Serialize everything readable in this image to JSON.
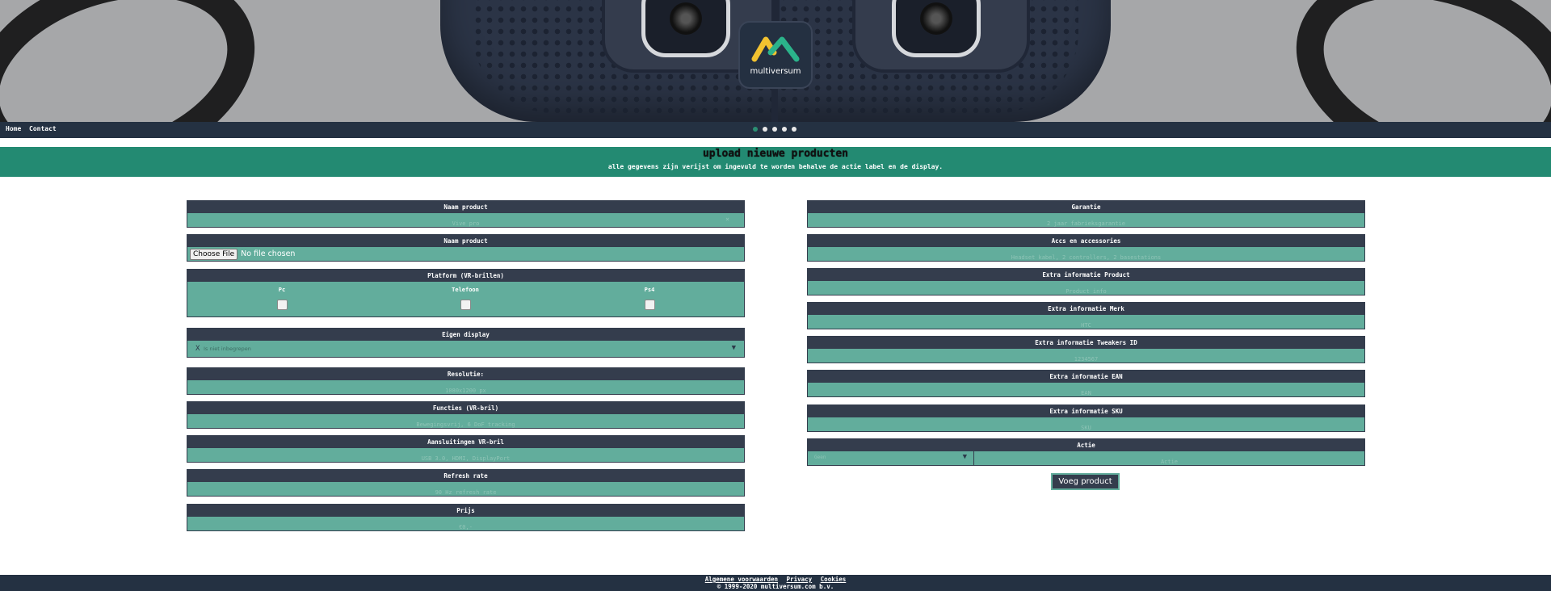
{
  "banner": {
    "logo_text": "multiversum",
    "slider_dots": 5,
    "active_dot": 0
  },
  "nav": {
    "home": "Home",
    "contact": "Contact"
  },
  "hero": {
    "title": "upload nieuwe producten",
    "subtitle": "alle gegevens zijn verijst om ingevuld te worden behalve de actie label en de display."
  },
  "left_fields": {
    "naam_product": {
      "label": "Naam product",
      "placeholder": "Vive pro",
      "clear": "×"
    },
    "afbeelding": {
      "label": "Naam product",
      "button": "Choose File",
      "status": "No file chosen"
    },
    "platform": {
      "label": "Platform (VR-brillen)",
      "options": [
        "Pc",
        "Telefoon",
        "Ps4"
      ]
    },
    "eigen_display": {
      "label": "Eigen display",
      "clear": "X",
      "value": "Is niet inbegrepen",
      "arrow": "▼"
    },
    "resolutie": {
      "label": "Resolutie:",
      "placeholder": "1080x1200 px"
    },
    "functies": {
      "label": "Functies (VR-bril)",
      "placeholder": "Bewegingsvrij, 6 DoF tracking"
    },
    "aansluitingen": {
      "label": "Aansluitingen VR-bril",
      "placeholder": "USB 3.0, HDMI, DisplayPort"
    },
    "refresh_rate": {
      "label": "Refresh rate",
      "placeholder": "90 Hz refresh rate"
    },
    "prijs": {
      "label": "Prijs",
      "placeholder": "€0,-"
    }
  },
  "right_fields": {
    "garantie": {
      "label": "Garantie",
      "placeholder": "2 jaar fabrieksgarantie"
    },
    "accs": {
      "label": "Accs en accessories",
      "placeholder": "Headset kabel, 2 controllers, 2 basestations"
    },
    "extra_product": {
      "label": "Extra informatie Product",
      "placeholder": "Product info"
    },
    "extra_merk": {
      "label": "Extra informatie Merk",
      "placeholder": "HTC"
    },
    "extra_tweakers": {
      "label": "Extra informatie Tweakers ID",
      "placeholder": "1234567"
    },
    "extra_ean": {
      "label": "Extra informatie EAN",
      "placeholder": "EAN"
    },
    "extra_sku": {
      "label": "Extra informatie SKU",
      "placeholder": "SKU"
    },
    "actie": {
      "label": "Actie",
      "select_value": "Geen",
      "arrow": "▼",
      "placeholder": "Actie"
    }
  },
  "submit": {
    "label": "Voeg product toe"
  },
  "footer": {
    "links": [
      "Algemene voorwaarden",
      "Privacy",
      "Cookies"
    ],
    "copyright": "© 1999-2020 multiversum.com b.v."
  },
  "colors": {
    "nav_bg": "#243142",
    "hero_bg": "#238a72",
    "label_bg": "#343d4d",
    "input_bg": "#62ad9c",
    "dot_active": "#2b8f73"
  }
}
